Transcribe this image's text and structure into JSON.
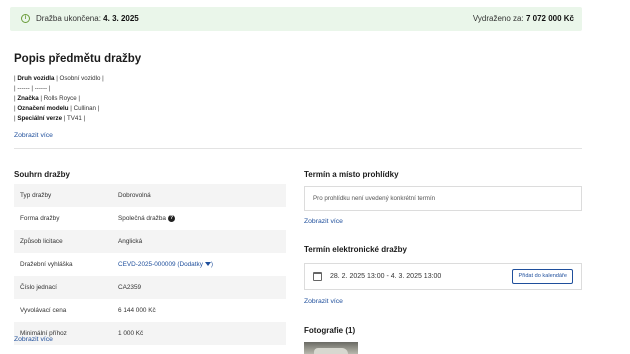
{
  "banner": {
    "ended_label": "Dražba ukončena:",
    "ended_date": "4. 3. 2025",
    "sold_label": "Vydraženo za:",
    "sold_amount": "7 072 000 Kč"
  },
  "description": {
    "title": "Popis předmětu dražby",
    "lines": [
      {
        "pre": "| ",
        "key": "Druh vozidla",
        "post": " | Osobní vozidlo |"
      },
      {
        "pre": "| ------ | ------ |",
        "key": "",
        "post": ""
      },
      {
        "pre": "| ",
        "key": "Značka",
        "post": " | Rolls Royce |"
      },
      {
        "pre": "| ",
        "key": "Označení modelu",
        "post": " | Cullinan |"
      },
      {
        "pre": "| ",
        "key": "Speciální verze",
        "post": " | TV41 |"
      }
    ],
    "show_more": "Zobrazit více"
  },
  "summary": {
    "title": "Souhrn dražby",
    "rows": [
      {
        "key": "Typ dražby",
        "value": "Dobrovolná"
      },
      {
        "key": "Forma dražby",
        "value": "Společná dražba"
      },
      {
        "key": "Způsob licitace",
        "value": "Anglická"
      },
      {
        "key": "Dražební vyhláška",
        "value": "CEVD-2025-000009 (Dodatky"
      },
      {
        "key": "Číslo jednací",
        "value": "CA2359"
      },
      {
        "key": "Vyvolávací cena",
        "value": "6 144 000 Kč"
      },
      {
        "key": "Minimální příhoz",
        "value": "1 000 Kč"
      }
    ],
    "show_more": "Zobrazit více"
  },
  "inspection": {
    "title": "Termín a místo prohlídky",
    "text": "Pro prohlídku není uvedený konkrétní termín",
    "show_more": "Zobrazit více"
  },
  "electronic_term": {
    "title": "Termín elektronické dražby",
    "datetime": "28. 2. 2025 13:00 - 4. 3. 2025 13:00",
    "add_calendar": "Přidat do kalendáře",
    "show_more": "Zobrazit více"
  },
  "photos": {
    "title": "Fotografie (1)"
  },
  "icons": {
    "banner": "info-icon",
    "form_help": "help-icon",
    "dropdown": "caret-down-icon",
    "calendar": "calendar-icon"
  },
  "colors": {
    "banner_bg": "#eaf6ea",
    "link": "#1f4f9c",
    "row_stripe": "#f4f4f4"
  }
}
